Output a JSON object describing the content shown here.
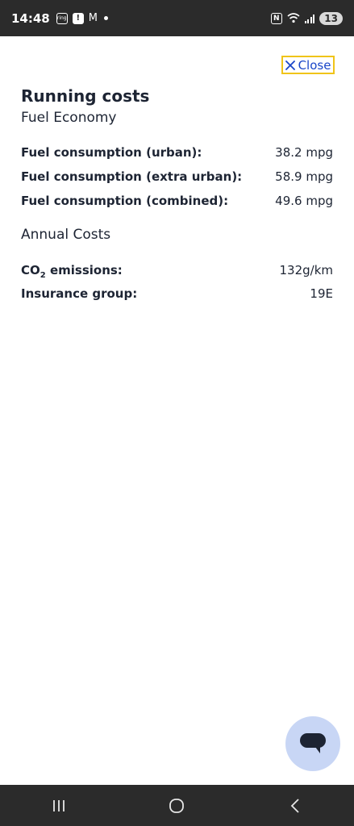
{
  "status_bar": {
    "time": "14:48",
    "notif_icons": [
      "ring-app-icon",
      "alert-icon",
      "gmail-icon"
    ],
    "ring_label": "ring",
    "alert_label": "!",
    "gmail_glyph": "M",
    "battery_level": "13"
  },
  "close": {
    "label": "Close",
    "color": "#1a46c8",
    "focus_color": "#f0c419"
  },
  "title": "Running costs",
  "fuel_economy": {
    "heading": "Fuel Economy",
    "rows": [
      {
        "label": "Fuel consumption (urban):",
        "value": "38.2 mpg"
      },
      {
        "label": "Fuel consumption (extra urban):",
        "value": "58.9 mpg"
      },
      {
        "label": "Fuel consumption (combined):",
        "value": "49.6 mpg"
      }
    ]
  },
  "annual_costs": {
    "heading": "Annual Costs",
    "rows": [
      {
        "label_main": "CO",
        "label_sub": "2",
        "label_tail": " emissions:",
        "value": "132g/km"
      },
      {
        "label": "Insurance group:",
        "value": "19E"
      }
    ]
  },
  "chat_button": {
    "icon": "chat-bubble-icon",
    "bg": "#c8d6f5"
  },
  "nav": {
    "icons": [
      "recent-apps-icon",
      "home-icon",
      "back-icon"
    ]
  }
}
